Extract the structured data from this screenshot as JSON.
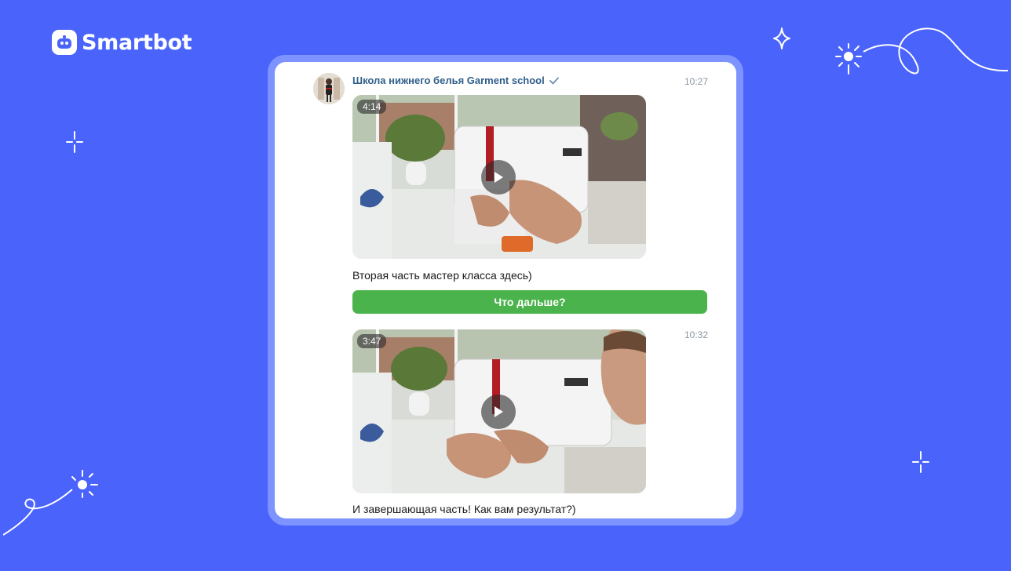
{
  "brand": {
    "name": "Smartbot"
  },
  "chat": {
    "sender": "Школа нижнего белья Garment school",
    "messages": [
      {
        "time": "10:27",
        "duration": "4:14",
        "text": "Вторая часть мастер класса здесь)"
      },
      {
        "time": "10:32",
        "duration": "3:47",
        "text": "И завершающая часть! Как вам результат?)"
      }
    ],
    "button_label": "Что дальше?"
  },
  "colors": {
    "background": "#4a63fb",
    "card_border": "#7d93ff",
    "button": "#4bb34b",
    "sender": "#2f5f8a"
  }
}
